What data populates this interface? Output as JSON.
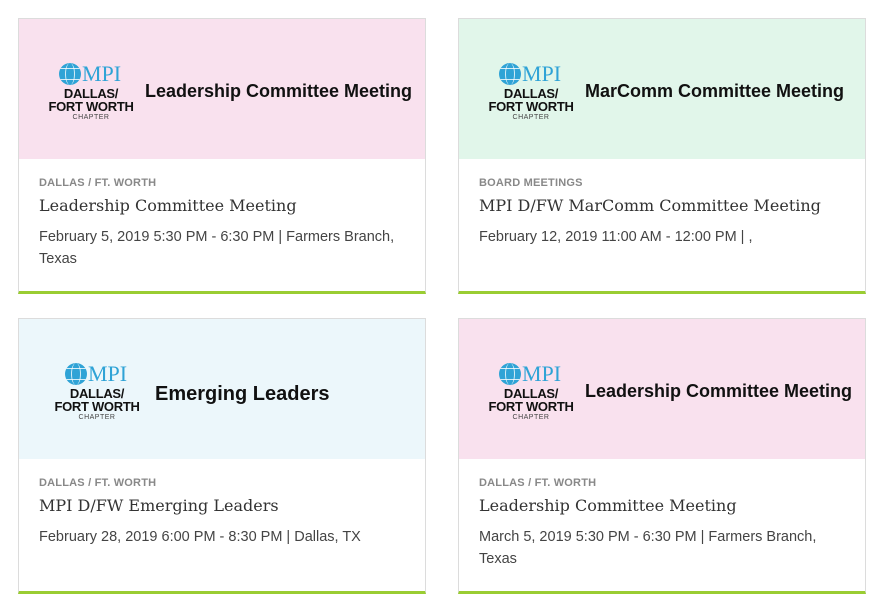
{
  "logo": {
    "mpi_text": "MPI",
    "city_line1": "DALLAS/",
    "city_line2": "FORT WORTH",
    "chapter": "CHAPTER"
  },
  "colors": {
    "pink_banner": "#f9e1ee",
    "mint_banner": "#e1f6ea",
    "sky_banner": "#ecf7fb",
    "accent_border": "#9acd32",
    "mpi_blue": "#2fa3d6"
  },
  "events": [
    {
      "banner_title": "Leadership Committee Meeting",
      "category": "DALLAS / FT. WORTH",
      "title": "Leadership Committee Meeting",
      "meta": "February 5, 2019 5:30 PM - 6:30 PM | Farmers Branch, Texas"
    },
    {
      "banner_title": "MarComm Committee Meeting",
      "category": "BOARD MEETINGS",
      "title": "MPI D/FW MarComm Committee Meeting",
      "meta": "February 12, 2019 11:00 AM - 12:00 PM | ,"
    },
    {
      "banner_title": "Emerging Leaders",
      "category": "DALLAS / FT. WORTH",
      "title": "MPI D/FW Emerging Leaders",
      "meta": "February 28, 2019 6:00 PM - 8:30 PM | Dallas, TX"
    },
    {
      "banner_title": "Leadership Committee Meeting",
      "category": "DALLAS / FT. WORTH",
      "title": "Leadership Committee Meeting",
      "meta": "March 5, 2019 5:30 PM - 6:30 PM | Farmers Branch, Texas"
    }
  ]
}
